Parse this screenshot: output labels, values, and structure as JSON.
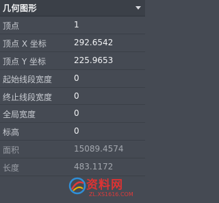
{
  "panel": {
    "title": "几何图形",
    "rows": [
      {
        "label": "顶点",
        "value": "1"
      },
      {
        "label": "顶点 X 坐标",
        "value": "292.6542"
      },
      {
        "label": "顶点 Y 坐标",
        "value": "225.9653"
      },
      {
        "label": "起始线段宽度",
        "value": "0"
      },
      {
        "label": "终止线段宽度",
        "value": "0"
      },
      {
        "label": "全局宽度",
        "value": "0"
      },
      {
        "label": "标高",
        "value": "0"
      },
      {
        "label": "面积",
        "value": "15089.4574"
      },
      {
        "label": "长度",
        "value": "483.1172"
      }
    ]
  },
  "watermark": {
    "brand": "资料网",
    "url": "ZL.XS1616.COM"
  },
  "colors": {
    "background": "#454a53",
    "header": "#3b4048",
    "watermark_red": "#d33"
  }
}
